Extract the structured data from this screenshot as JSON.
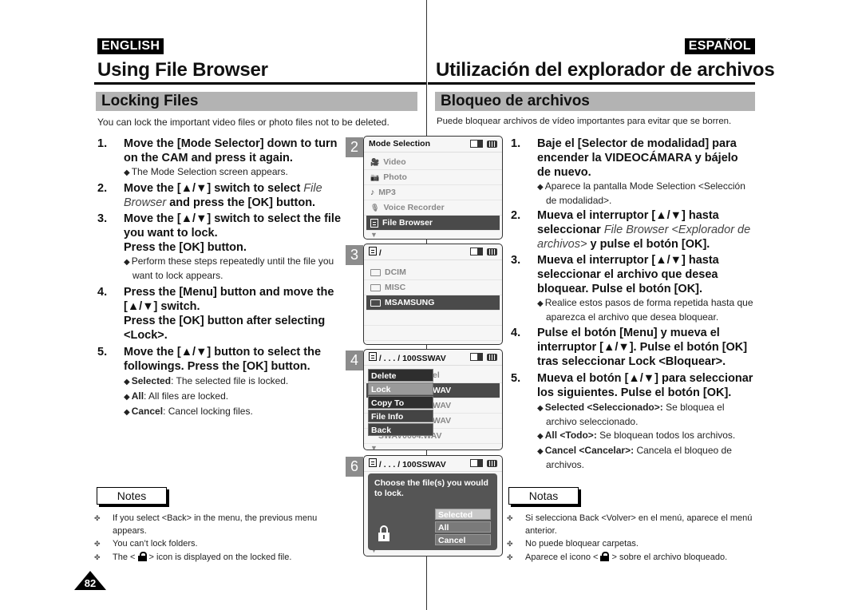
{
  "header": {
    "lang_en": "ENGLISH",
    "lang_es": "ESPAÑOL",
    "title_en": "Using File Browser",
    "title_es": "Utilización del explorador de archivos"
  },
  "section": {
    "title_en": "Locking Files",
    "title_es": "Bloqueo de archivos",
    "intro_en": "You can lock the important video files or photo files not to be deleted.",
    "intro_es": "Puede bloquear archivos de vídeo  importantes para evitar que se borren."
  },
  "steps_en": [
    {
      "num": "1.",
      "text": "Move the [Mode Selector] down to turn on the CAM and press it again.",
      "subs": [
        "The Mode Selection screen appears."
      ]
    },
    {
      "num": "2.",
      "text_pre": "Move the [▲/▼] switch to select ",
      "text_italic": "File Browser",
      "text_post": " and press the [OK] button.",
      "subs": []
    },
    {
      "num": "3.",
      "text": "Move the [▲/▼] switch to select the file you want to lock.",
      "text2": "Press the [OK] button.",
      "subs": [
        "Perform these steps repeatedly until the file you want to lock appears."
      ]
    },
    {
      "num": "4.",
      "text": "Press the [Menu] button and move the [▲/▼] switch.",
      "text2": "Press the [OK] button after selecting <Lock>.",
      "subs": []
    },
    {
      "num": "5.",
      "text": "Move the [▲/▼] button to select the followings. Press the [OK] button.",
      "subs_kv": [
        {
          "key": "Selected",
          "val": ": The selected file is locked."
        },
        {
          "key": "All",
          "val": ": All files are locked."
        },
        {
          "key": "Cancel",
          "val": ": Cancel locking files."
        }
      ]
    }
  ],
  "steps_es": [
    {
      "num": "1.",
      "text": "Baje el [Selector de modalidad] para encender la VIDEOCÁMARA y bájelo de nuevo.",
      "subs": [
        "Aparece la pantalla Mode Selection <Selección de modalidad>."
      ]
    },
    {
      "num": "2.",
      "text_pre": "Mueva el interruptor [▲/▼] hasta seleccionar ",
      "text_italic": "File Browser <Explorador de archivos>",
      "text_post": " y pulse el botón [OK].",
      "subs": []
    },
    {
      "num": "3.",
      "text": "Mueva el interruptor [▲/▼] hasta seleccionar el archivo que desea bloquear. Pulse el botón [OK].",
      "subs": [
        "Realice estos pasos de forma repetida hasta que aparezca el archivo que desea bloquear."
      ]
    },
    {
      "num": "4.",
      "text": "Pulse el botón [Menu] y mueva el interruptor [▲/▼]. Pulse el botón [OK] tras seleccionar Lock <Bloquear>.",
      "subs": []
    },
    {
      "num": "5.",
      "text": "Mueva el botón [▲/▼] para seleccionar los siguientes.  Pulse el botón [OK].",
      "subs_kv": [
        {
          "key": "Selected <Seleccionado>:",
          "val": " Se bloquea el archivo seleccionado."
        },
        {
          "key": "All <Todo>:",
          "val": " Se bloquean todos los archivos."
        },
        {
          "key": "Cancel <Cancelar>:",
          "val": "  Cancela el bloqueo de archivos."
        }
      ]
    }
  ],
  "screens": {
    "s2": {
      "num": "2",
      "title": "Mode Selection",
      "items": [
        {
          "icon": "video-icon",
          "glyph": "🎥",
          "label": "Video"
        },
        {
          "icon": "photo-icon",
          "glyph": "📷",
          "label": "Photo"
        },
        {
          "icon": "music-note-icon",
          "glyph": "♪",
          "label": "MP3"
        },
        {
          "icon": "microphone-icon",
          "glyph": "🎙",
          "label": "Voice Recorder"
        },
        {
          "icon": "document-icon",
          "glyph": "",
          "label": "File Browser",
          "selected": true
        }
      ]
    },
    "s3": {
      "num": "3",
      "path": "/",
      "items": [
        {
          "label": "DCIM"
        },
        {
          "label": "MISC"
        },
        {
          "label": "MSAMSUNG",
          "selected": true
        }
      ]
    },
    "s4": {
      "num": "4",
      "path": "/ . . . / 100SSWAV",
      "bg_items": [
        "el",
        "WAV",
        "WAV",
        "WAV",
        "SWAV0004.WAV"
      ],
      "menu": [
        "Delete",
        "Lock",
        "Copy To",
        "File Info",
        "Back"
      ],
      "menu_selected": "Lock"
    },
    "s6": {
      "num": "6",
      "path": "/ . . . / 100SSWAV",
      "message": "Choose the file(s) you would to lock.",
      "options": [
        "Selected",
        "All",
        "Cancel"
      ],
      "selected_option": "Selected"
    }
  },
  "notes": {
    "title_en": "Notes",
    "title_es": "Notas",
    "en": [
      "If you select <Back> in the menu, the previous menu appears.",
      "You can’t lock folders.",
      {
        "pre": "The < ",
        "post": " > icon is displayed on the locked file."
      }
    ],
    "es": [
      "Si selecciona Back <Volver> en el menú, aparece el menú anterior.",
      "No puede bloquear carpetas.",
      {
        "pre": "Aparece el icono < ",
        "post": " > sobre el archivo bloqueado."
      }
    ]
  },
  "page_number": "82"
}
